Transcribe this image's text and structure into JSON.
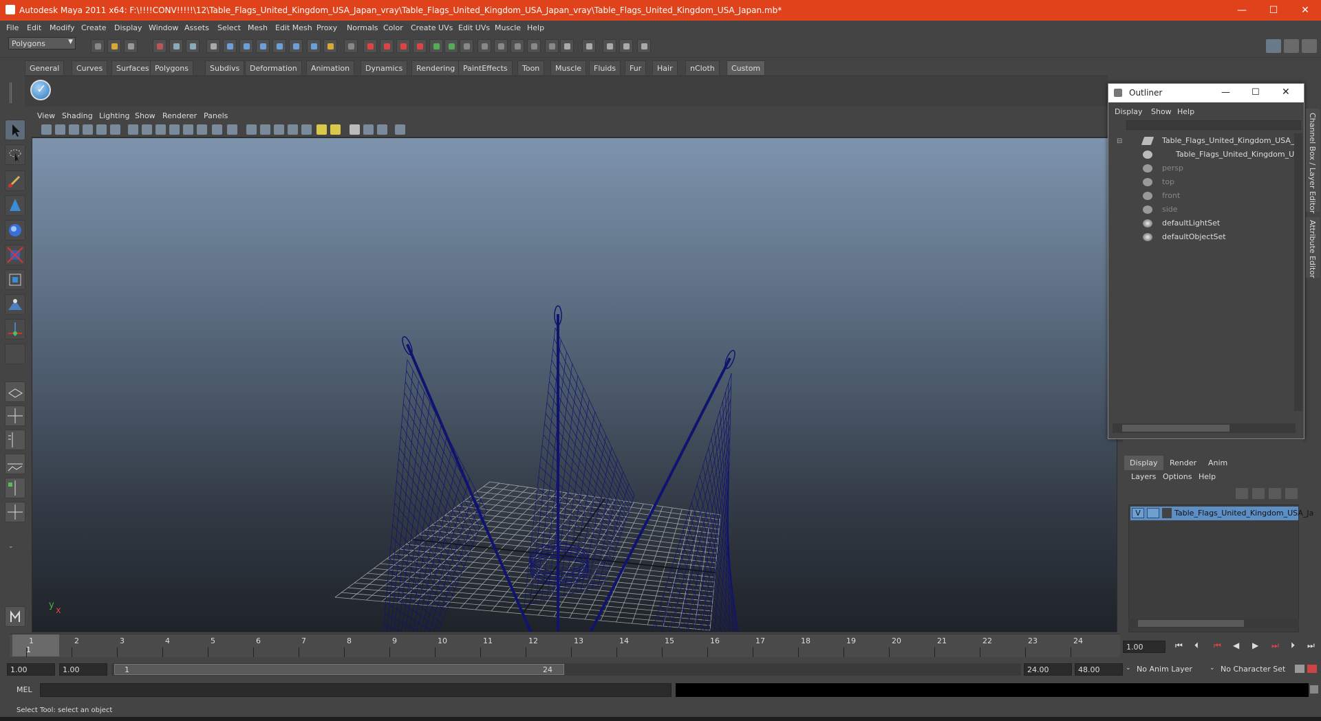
{
  "window": {
    "title": "Autodesk Maya 2011 x64: F:\\!!!!CONV!!!!!\\12\\Table_Flags_United_Kingdom_USA_Japan_vray\\Table_Flags_United_Kingdom_USA_Japan_vray\\Table_Flags_United_Kingdom_USA_Japan.mb*",
    "minimize": "—",
    "maximize": "☐",
    "close": "✕"
  },
  "menus": [
    "File",
    "Edit",
    "Modify",
    "Create",
    "Display",
    "Window",
    "Assets",
    "Select",
    "Mesh",
    "Edit Mesh",
    "Proxy",
    "Normals",
    "Color",
    "Create UVs",
    "Edit UVs",
    "Muscle",
    "Help"
  ],
  "mode_select": "Polygons",
  "shelf_tabs": [
    "General",
    "Curves",
    "Surfaces",
    "Polygons",
    "Subdivs",
    "Deformation",
    "Animation",
    "Dynamics",
    "Rendering",
    "PaintEffects",
    "Toon",
    "Muscle",
    "Fluids",
    "Fur",
    "Hair",
    "nCloth",
    "Custom"
  ],
  "active_shelf": "Custom",
  "panel_menus": [
    "View",
    "Shading",
    "Lighting",
    "Show",
    "Renderer",
    "Panels"
  ],
  "axis": {
    "y": "y",
    "x": "x"
  },
  "outliner": {
    "title": "Outliner",
    "menus": [
      "Display",
      "Show",
      "Help"
    ],
    "items": [
      {
        "label": "Table_Flags_United_Kingdom_USA_Japa",
        "dim": false
      },
      {
        "label": "Table_Flags_United_Kingdom_USA_",
        "dim": false
      },
      {
        "label": "persp",
        "dim": true
      },
      {
        "label": "top",
        "dim": true
      },
      {
        "label": "front",
        "dim": true
      },
      {
        "label": "side",
        "dim": true
      },
      {
        "label": "defaultLightSet",
        "dim": false
      },
      {
        "label": "defaultObjectSet",
        "dim": false
      }
    ]
  },
  "side_tabs": {
    "channel_box": "Channel Box / Layer Editor",
    "attribute_editor": "Attribute Editor"
  },
  "layer_editor": {
    "tabs": [
      "Display",
      "Render",
      "Anim"
    ],
    "menus": [
      "Layers",
      "Options",
      "Help"
    ],
    "layer_visible": "V",
    "layer_name": "Table_Flags_United_Kingdom_USA_Ja"
  },
  "timeline": {
    "frames": [
      "1",
      "2",
      "3",
      "4",
      "5",
      "6",
      "7",
      "8",
      "9",
      "10",
      "11",
      "12",
      "13",
      "14",
      "15",
      "16",
      "17",
      "18",
      "19",
      "20",
      "21",
      "22",
      "23",
      "24"
    ],
    "current_frame_marker": "1",
    "current_time": "1.00"
  },
  "range": {
    "start": "1.00",
    "anim_start": "1.00",
    "slider_start": "1",
    "slider_end": "24",
    "end": "24.00",
    "anim_end": "48.00",
    "anim_layer": "No Anim Layer",
    "character_set": "No Character Set"
  },
  "command": {
    "label": "MEL",
    "value": ""
  },
  "help_line": "Select Tool: select an object",
  "colors": {
    "titlebar": "#e0421b",
    "wire": "#10146e",
    "grid": "#c8c8c8"
  }
}
